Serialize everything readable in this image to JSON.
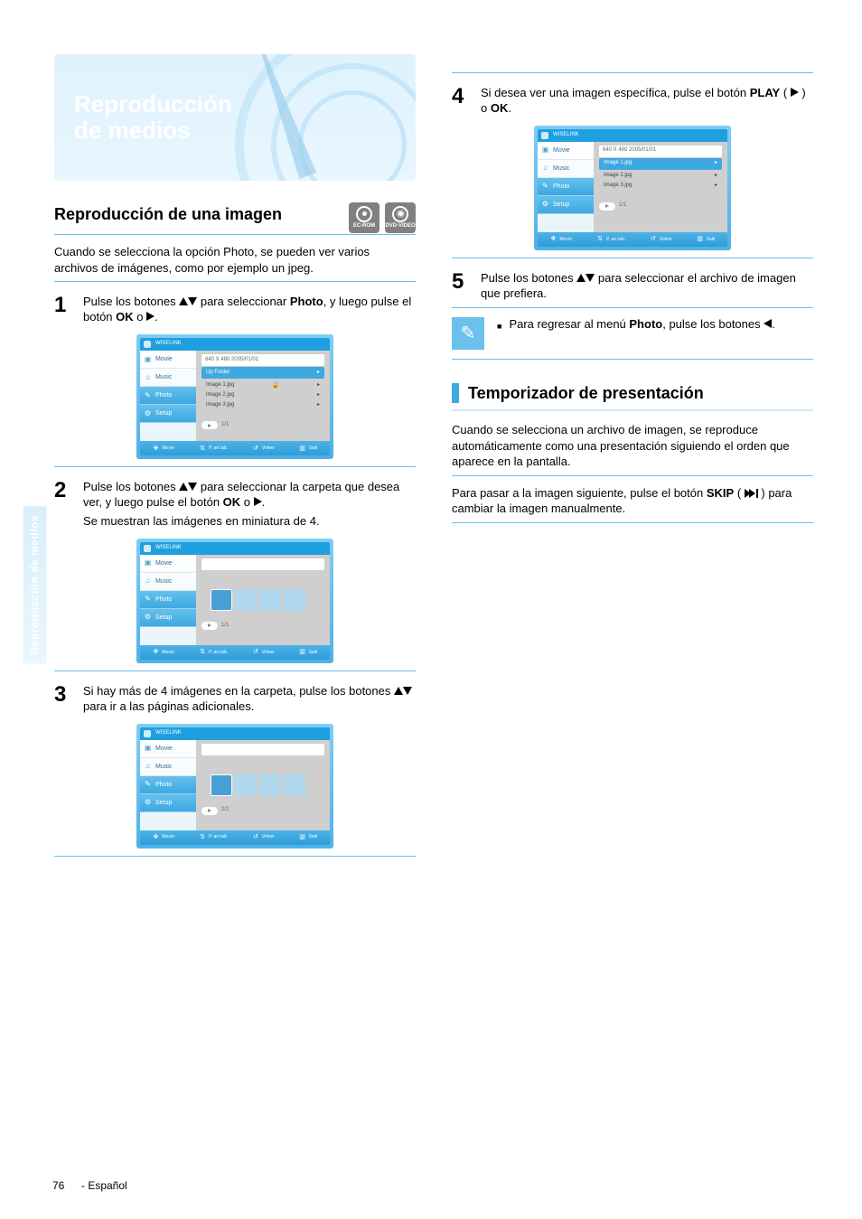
{
  "hero_title_line1": "Reproducción",
  "hero_title_line2": "de medios",
  "section_title": "Reproducción de una imagen",
  "badges": [
    "EC-ROM",
    "DVD-VIDEO"
  ],
  "intro": "Cuando se selecciona la opción Photo, se pueden ver varios archivos de imágenes, como por ejemplo un jpeg.",
  "steps": {
    "s1_pre": "Pulse los botones ",
    "s1_mid": " para seleccionar ",
    "s1_photo": "Photo",
    "s1_after_photo": ", y luego pulse el botón ",
    "s1_ok": "OK",
    "s1_or": " o ",
    "s1_end": ".",
    "s2_pre": "Pulse los botones ",
    "s2_mid": " para seleccionar la carpeta que desea ver, y luego pulse el botón ",
    "s2_ok": "OK",
    "s2_or": " o ",
    "s2_end": ".",
    "s2_sub": "Se muestran las imágenes en miniatura de 4.",
    "s3": {
      "pre": "Si hay más de 4 imágenes en la carpeta, pulse los botones ",
      "mid": " para ir a las páginas adicionales.",
      "note_label": "▼",
      "note_label_up": "▲"
    },
    "s4_pre": "Si desea ver una imagen específica, pulse el botón ",
    "s4_play": "PLAY",
    "s4_or": " o ",
    "s4_end": ".",
    "s5_pre": "Pulse los botones ",
    "s5_mid": " para seleccionar el archivo de imagen que prefiera.",
    "note_pre": "Para regresar al menú ",
    "note_photo": "Photo",
    "note_mid": ", pulse los botones ",
    "note_end": "."
  },
  "subsection_title": "Temporizador de presentación",
  "sub_p1": "Cuando se selecciona un archivo de imagen, se reproduce automáticamente como una presentación siguiendo el orden que aparece en la pantalla.",
  "sub_p2_pre": "Para pasar a la imagen siguiente, pulse el botón ",
  "sub_p2_skip": "SKIP",
  "sub_p2_paren": " ( ",
  "sub_p2_paren_end": " ) ",
  "sub_p2_end": " para cambiar la imagen manualmente.",
  "screens": {
    "title_label": "WISELINK",
    "sidebar": {
      "movie": "Movie",
      "music": "Music",
      "photo": "Photo",
      "setup": "Setup"
    },
    "s1": {
      "crumb": "640 X 480  2005/01/01",
      "rows": [
        "Up Folder",
        "Image 1.jpg",
        "Image 2.jpg",
        "Image 3.jpg"
      ],
      "page": "1/1"
    },
    "s4": {
      "crumb": "640 X 480  2005/01/01",
      "rows": [
        "Image 1.jpg",
        "Image 2.jpg",
        "Image 3.jpg"
      ],
      "page": "1/1"
    },
    "s2": {
      "page": "1/1"
    },
    "s3": {
      "page": "2/2"
    },
    "bottombar": {
      "left": "Mover",
      "mid1": "P. arr./ab.",
      "mid2": "Volver",
      "right": "Salir"
    }
  },
  "side_label": "Reproducción de medios",
  "page_number": "76",
  "page_footer": "- Español"
}
